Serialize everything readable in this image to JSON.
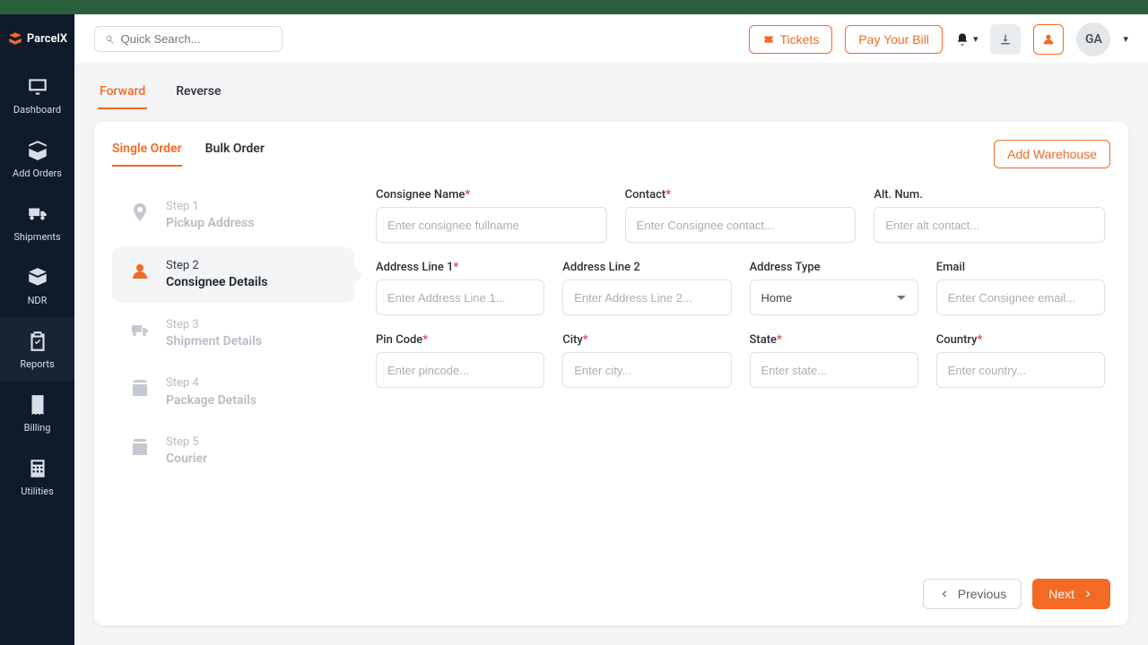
{
  "brand": "ParcelX",
  "accent": "#f26a24",
  "sidebar": {
    "items": [
      {
        "label": "Dashboard"
      },
      {
        "label": "Add Orders"
      },
      {
        "label": "Shipments"
      },
      {
        "label": "NDR"
      },
      {
        "label": "Reports"
      },
      {
        "label": "Billing"
      },
      {
        "label": "Utilities"
      }
    ]
  },
  "topbar": {
    "search_placeholder": "Quick Search...",
    "tickets_label": "Tickets",
    "pay_bill_label": "Pay Your Bill",
    "avatar_initials": "GA"
  },
  "direction_tabs": {
    "forward": "Forward",
    "reverse": "Reverse",
    "active": "Forward"
  },
  "order_tabs": {
    "single": "Single Order",
    "bulk": "Bulk Order",
    "active": "Single Order"
  },
  "add_warehouse_label": "Add Warehouse",
  "steps": [
    {
      "small": "Step 1",
      "big": "Pickup Address"
    },
    {
      "small": "Step 2",
      "big": "Consignee Details"
    },
    {
      "small": "Step 3",
      "big": "Shipment Details"
    },
    {
      "small": "Step 4",
      "big": "Package Details"
    },
    {
      "small": "Step 5",
      "big": "Courier"
    }
  ],
  "active_step_index": 1,
  "form": {
    "consignee_name": {
      "label": "Consignee Name",
      "placeholder": "Enter consignee fullname",
      "required": true
    },
    "contact": {
      "label": "Contact",
      "placeholder": "Enter Consignee contact...",
      "required": true
    },
    "alt_num": {
      "label": "Alt. Num.",
      "placeholder": "Enter alt contact...",
      "required": false
    },
    "addr1": {
      "label": "Address Line 1",
      "placeholder": "Enter Address Line 1...",
      "required": true
    },
    "addr2": {
      "label": "Address Line 2",
      "placeholder": "Enter Address Line 2...",
      "required": false
    },
    "address_type": {
      "label": "Address Type",
      "selected": "Home",
      "options": [
        "Home"
      ]
    },
    "email": {
      "label": "Email",
      "placeholder": "Enter Consignee email...",
      "required": false
    },
    "pin": {
      "label": "Pin Code",
      "placeholder": "Enter pincode...",
      "required": true
    },
    "city": {
      "label": "City",
      "placeholder": "Enter city...",
      "required": true
    },
    "state": {
      "label": "State",
      "placeholder": "Enter state...",
      "required": true
    },
    "country": {
      "label": "Country",
      "placeholder": "Enter country...",
      "required": true
    }
  },
  "footer": {
    "previous": "Previous",
    "next": "Next"
  }
}
